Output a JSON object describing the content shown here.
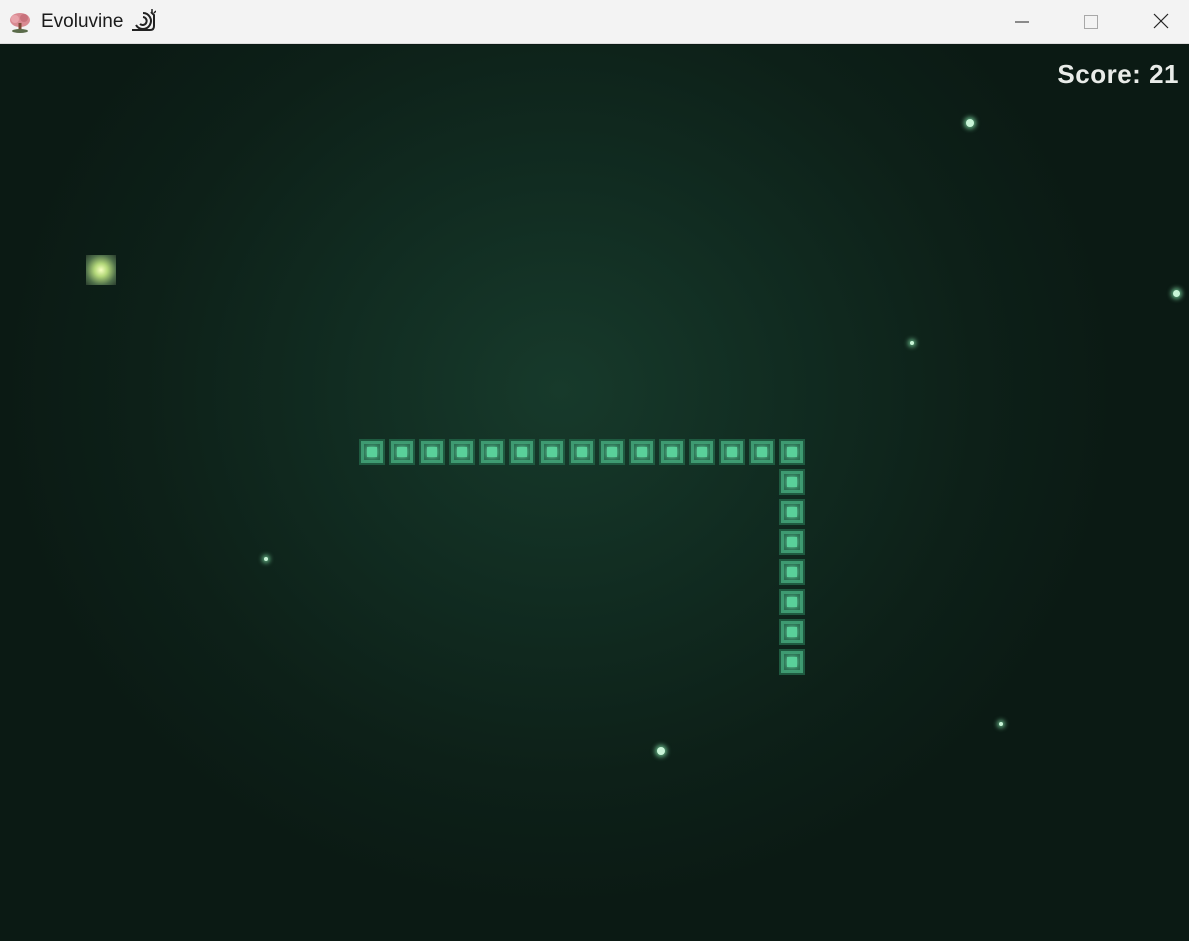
{
  "window": {
    "title": "Evoluvine",
    "icon": "tree-icon",
    "title_suffix_icon": "snail-icon",
    "controls": [
      "minimize-icon",
      "maximize-icon",
      "close-icon"
    ]
  },
  "hud": {
    "score_label": "Score: 21"
  },
  "game": {
    "snake_color": "#3e9a71",
    "food_color": "#d8f08a",
    "background_color": "#112c21",
    "snake_segments": [
      {
        "col": 0,
        "row": 0
      },
      {
        "col": 1,
        "row": 0
      },
      {
        "col": 2,
        "row": 0
      },
      {
        "col": 3,
        "row": 0
      },
      {
        "col": 4,
        "row": 0
      },
      {
        "col": 5,
        "row": 0
      },
      {
        "col": 6,
        "row": 0
      },
      {
        "col": 7,
        "row": 0
      },
      {
        "col": 8,
        "row": 0
      },
      {
        "col": 9,
        "row": 0
      },
      {
        "col": 10,
        "row": 0
      },
      {
        "col": 11,
        "row": 0
      },
      {
        "col": 12,
        "row": 0
      },
      {
        "col": 13,
        "row": 0
      },
      {
        "col": 14,
        "row": 0
      },
      {
        "col": 14,
        "row": 1
      },
      {
        "col": 14,
        "row": 2
      },
      {
        "col": 14,
        "row": 3
      },
      {
        "col": 14,
        "row": 4
      },
      {
        "col": 14,
        "row": 5
      },
      {
        "col": 14,
        "row": 6
      },
      {
        "col": 14,
        "row": 7
      }
    ]
  }
}
